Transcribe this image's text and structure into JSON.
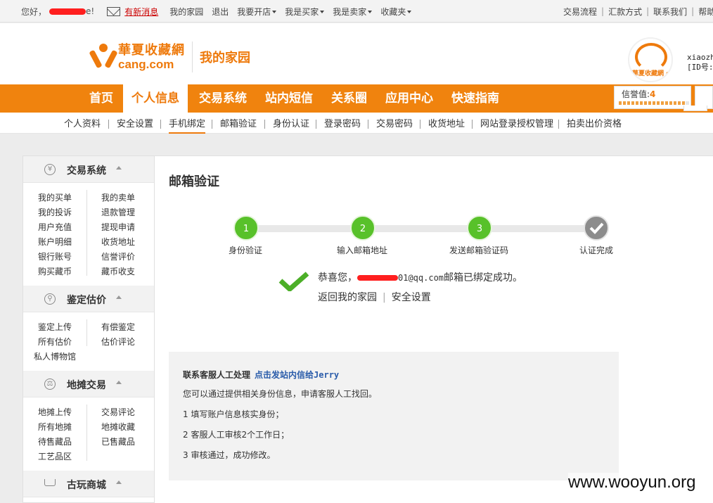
{
  "topbar": {
    "greeting": "您好，",
    "greeting_end": "e!",
    "new_message": "有新消息",
    "links": [
      {
        "label": "我的家园",
        "caret": false
      },
      {
        "label": "退出",
        "caret": false
      },
      {
        "label": "我要开店",
        "caret": true
      },
      {
        "label": "我是买家",
        "caret": true
      },
      {
        "label": "我是卖家",
        "caret": true
      },
      {
        "label": "收藏夹",
        "caret": true
      }
    ],
    "right_links": [
      "交易流程",
      "汇款方式",
      "联系我们",
      "帮助"
    ]
  },
  "header": {
    "logo_cn": "華夏收藏網",
    "logo_en": "cang.com",
    "home_label": "我的家园",
    "avatar_text": "華夏收藏網 cang.com",
    "username": "xiaozh",
    "id_label": "[ID号:"
  },
  "nav": {
    "items": [
      "首页",
      "个人信息",
      "交易系统",
      "站内短信",
      "关系圈",
      "应用中心",
      "快速指南"
    ],
    "active_index": 1,
    "credit_label": "信誉值:",
    "credit_value": "4",
    "credit_level": 0.95
  },
  "subnav": {
    "items": [
      "个人资料",
      "安全设置",
      "手机绑定",
      "邮箱验证",
      "身份认证",
      "登录密码",
      "交易密码",
      "收货地址",
      "网站登录授权管理",
      "拍卖出价资格"
    ],
    "active_index": 2
  },
  "sidebar": {
    "sections": [
      {
        "title": "交易系统",
        "icon": "yen-icon",
        "icon_glyph": "¥",
        "links": [
          "我的买单",
          "我的卖单",
          "我的投诉",
          "退款管理",
          "用户充值",
          "提现申请",
          "账户明细",
          "收货地址",
          "银行账号",
          "信誉评价",
          "购买藏币",
          "藏币收支"
        ]
      },
      {
        "title": "鉴定估价",
        "icon": "magnifier-icon",
        "icon_glyph": "⚲",
        "links": [
          "鉴定上传",
          "有偿鉴定",
          "所有估价",
          "估价评论",
          "私人博物馆"
        ]
      },
      {
        "title": "地摊交易",
        "icon": "scale-icon",
        "icon_glyph": "⚖",
        "links": [
          "地摊上传",
          "交易评论",
          "所有地摊",
          "地摊收藏",
          "待售藏品",
          "已售藏品",
          "工艺品区"
        ]
      },
      {
        "title": "古玩商城",
        "icon": "cart-icon",
        "icon_glyph": "",
        "links": []
      }
    ]
  },
  "main": {
    "title": "邮箱验证",
    "steps": [
      {
        "num": "1",
        "label": "身份验证"
      },
      {
        "num": "2",
        "label": "输入邮箱地址"
      },
      {
        "num": "3",
        "label": "发送邮箱验证码"
      },
      {
        "num": "",
        "label": "认证完成"
      }
    ],
    "success_prefix": "恭喜您，",
    "success_email_tail": "01@qq.com",
    "success_suffix": "邮箱已绑定成功。",
    "link_home": "返回我的家园",
    "link_security": "安全设置",
    "help_title": "联系客服人工处理",
    "help_link": "点击发站内信给Jerry",
    "help_intro": "您可以通过提供相关身份信息，申请客服人工找回。",
    "help_steps": [
      "1 填写账户信息核实身份；",
      "2 客服人工审核2个工作日；",
      "3 审核通过，成功修改。"
    ]
  },
  "watermark": "www.wooyun.org",
  "colors": {
    "accent": "#f0830e",
    "step_green": "#58c12a",
    "check_green": "#4caf28",
    "link_blue": "#2a5caa",
    "alert_red": "#cc0000"
  }
}
